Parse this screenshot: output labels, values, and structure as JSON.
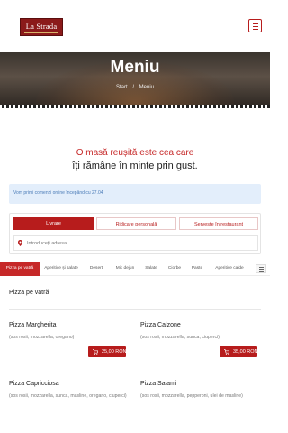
{
  "header": {
    "logo_text": "La Strada",
    "menu_icon": "hamburger-icon"
  },
  "hero": {
    "title": "Meniu",
    "breadcrumb": [
      "Start",
      "/",
      "Meniu"
    ]
  },
  "slogan": {
    "line1": "O masă reușită este cea care",
    "line2": "îți rămâne în minte prin gust."
  },
  "notice": "Vom primi comenzi online începând cu 27.04",
  "order": {
    "tabs": [
      "Livrare",
      "Ridicare personală",
      "Servește în restaurant"
    ],
    "address_placeholder": "Introduceți adresa"
  },
  "categories": [
    "Pizza pe vatră",
    "Aperitive și salate",
    "Desert",
    "Mic dejun",
    "Salate",
    "Ciorbe",
    "Paste",
    "Aperitive calde"
  ],
  "section": {
    "title": "Pizza pe vatră"
  },
  "items": [
    {
      "name": "Pizza  Margherita",
      "desc": "(sos rosii, mozzarella, oregano)",
      "price": "25,00  RON"
    },
    {
      "name": "Pizza Calzone",
      "desc": "(sos rosii, mozzarella, sunca, ciuperci)",
      "price": "35,00  RON"
    },
    {
      "name": "Pizza Capricciosa",
      "desc": "(sos rosii, mozzarella, sunca, masline, oregano, ciuperci)",
      "price": ""
    },
    {
      "name": "Pizza Salami",
      "desc": "(sos rosii, mozzarella, pepperoni, ulei de masline)",
      "price": ""
    }
  ],
  "colors": {
    "brand": "#b71c1c",
    "notice_bg": "#e3eefb",
    "notice_text": "#4a7bb7"
  }
}
